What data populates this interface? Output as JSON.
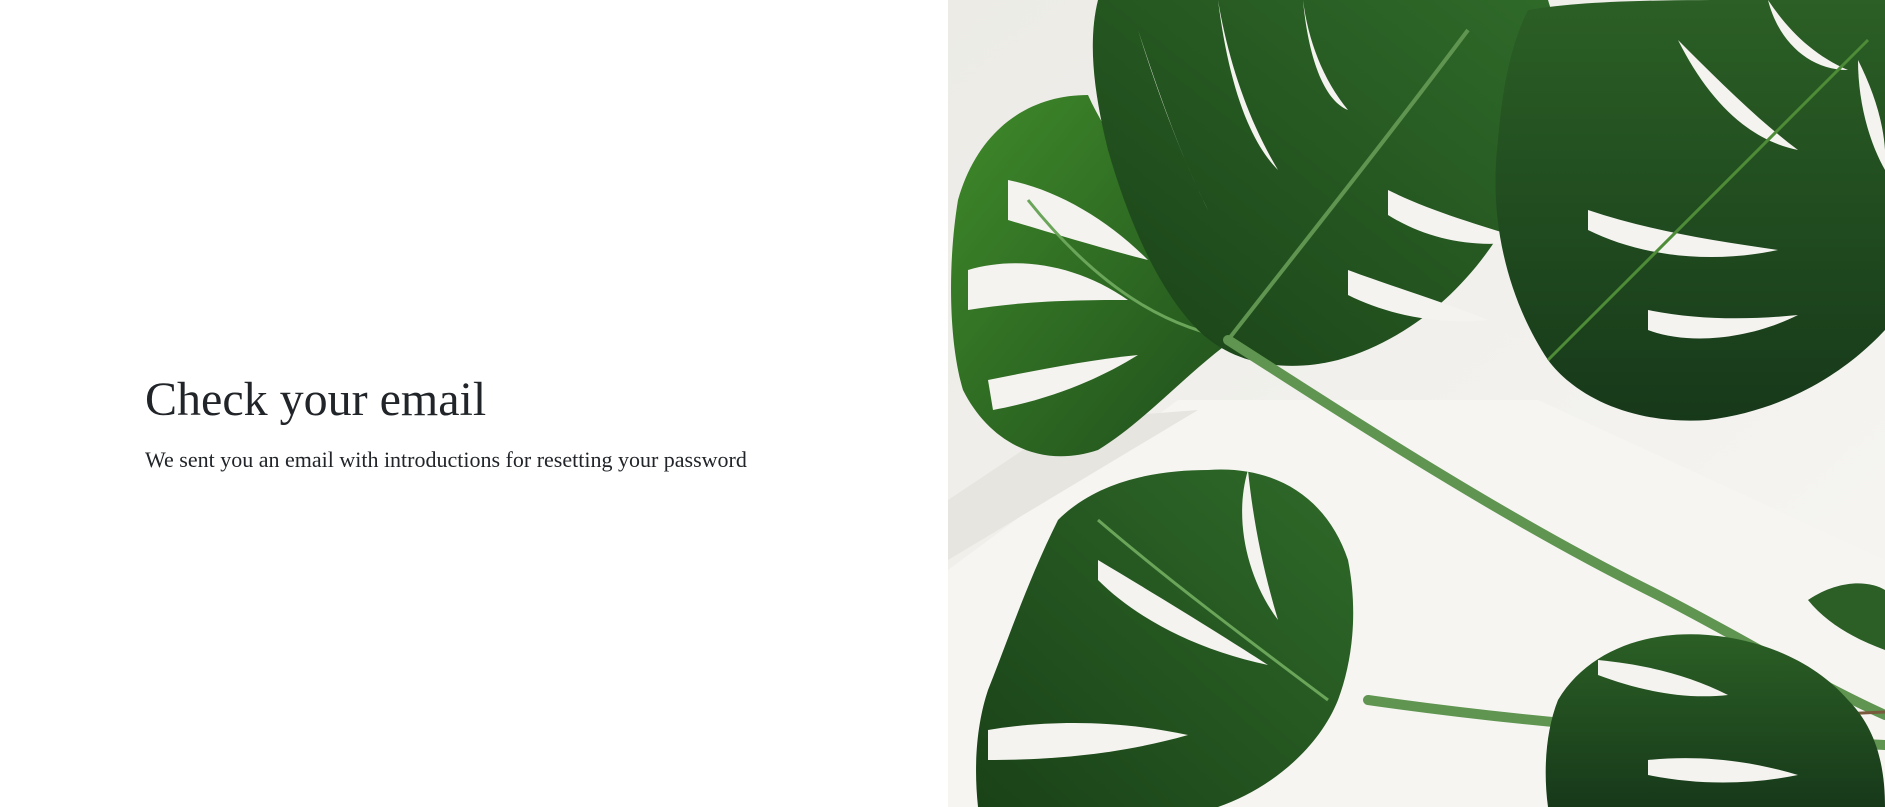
{
  "main": {
    "heading": "Check your email",
    "message": "We sent you an email with introductions for resetting your password"
  },
  "image": {
    "icon": "monstera-leaves-image",
    "colors": {
      "background": "#f1f0ec",
      "wall_shadow": "#e4e3de",
      "leaf_dark": "#1f4d1c",
      "leaf_mid": "#2f6a29",
      "leaf_light": "#4e8c38",
      "stem": "#5f9550",
      "hole": "#f4f3ef"
    }
  }
}
